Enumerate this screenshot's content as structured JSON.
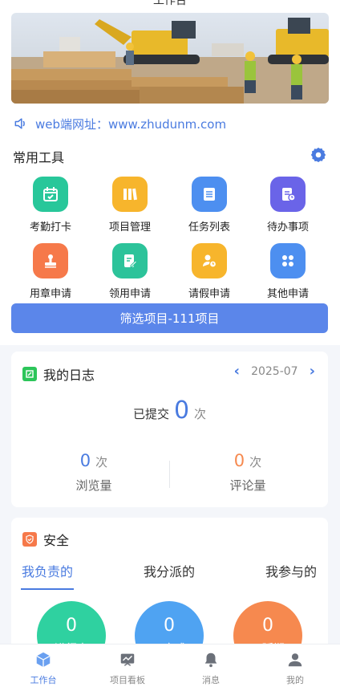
{
  "app": {
    "header_title": "工作台"
  },
  "notice": {
    "text": "web端网址：www.zhudunm.com"
  },
  "tools": {
    "title": "常用工具",
    "items": [
      {
        "label": "考勤打卡",
        "icon": "calendar-check-icon",
        "color": "#28c79a"
      },
      {
        "label": "项目管理",
        "icon": "books-icon",
        "color": "#f7b52c"
      },
      {
        "label": "任务列表",
        "icon": "list-icon",
        "color": "#4d8ff0"
      },
      {
        "label": "待办事项",
        "icon": "todo-clock-icon",
        "color": "#6a64e8"
      },
      {
        "label": "用章申请",
        "icon": "stamp-icon",
        "color": "#f6794a"
      },
      {
        "label": "领用申请",
        "icon": "edit-form-icon",
        "color": "#2cc39a"
      },
      {
        "label": "请假申请",
        "icon": "person-clock-icon",
        "color": "#f7b52c"
      },
      {
        "label": "其他申请",
        "icon": "grid-clover-icon",
        "color": "#4d8ff0"
      }
    ]
  },
  "filter": {
    "label": "筛选项目-111项目"
  },
  "journal": {
    "title": "我的日志",
    "month": "2025-07",
    "submitted_prefix": "已提交",
    "submitted_count": "0",
    "submitted_unit": "次",
    "views_count": "0",
    "views_unit": "次",
    "views_label": "浏览量",
    "comments_count": "0",
    "comments_unit": "次",
    "comments_label": "评论量"
  },
  "safety": {
    "title": "安全",
    "tabs": [
      "我负责的",
      "我分派的",
      "我参与的"
    ],
    "stats": [
      {
        "count": "0",
        "label": "进行中",
        "color": "#2fd1a0"
      },
      {
        "count": "0",
        "label": "已完成",
        "color": "#4fa3f2"
      },
      {
        "count": "0",
        "label": "已延期",
        "color": "#f6894f"
      }
    ]
  },
  "tabbar": [
    {
      "label": "工作台",
      "icon": "cube-icon",
      "active": true
    },
    {
      "label": "项目看板",
      "icon": "chart-board-icon",
      "active": false
    },
    {
      "label": "消息",
      "icon": "bell-icon",
      "active": false
    },
    {
      "label": "我的",
      "icon": "user-icon",
      "active": false
    }
  ],
  "colors": {
    "accent": "#4a7be0",
    "filter_button": "#5b86ea",
    "comments_number": "#f6894f"
  }
}
